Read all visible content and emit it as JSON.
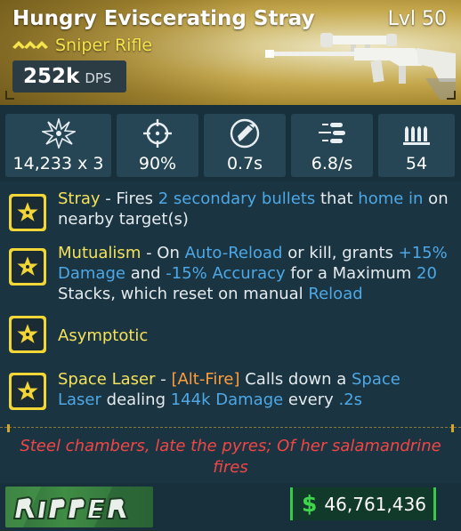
{
  "item": {
    "name": "Hungry Eviscerating Stray",
    "level": "Lvl 50",
    "rarity_icon": "legendary-chevrons-icon",
    "weapon_type": "Sniper Rifle",
    "dps_value": "252k",
    "dps_label": "DPS",
    "image": "sniper-rifle-image"
  },
  "stats": [
    {
      "icon": "damage-burst-icon",
      "value": "14,233 x 3"
    },
    {
      "icon": "crosshair-icon",
      "value": "90%"
    },
    {
      "icon": "reload-icon",
      "value": "0.7s"
    },
    {
      "icon": "fire-rate-icon",
      "value": "6.8/s"
    },
    {
      "icon": "magazine-icon",
      "value": "54"
    }
  ],
  "perks": [
    {
      "icon": "star-perk-icon",
      "name": "Stray",
      "segments": [
        {
          "t": " - Fires ",
          "c": ""
        },
        {
          "t": "2 secondary bullets",
          "c": "blue"
        },
        {
          "t": " that ",
          "c": ""
        },
        {
          "t": "home in",
          "c": "blue"
        },
        {
          "t": " on nearby target(s)",
          "c": ""
        }
      ]
    },
    {
      "icon": "star-perk-icon",
      "name": "Mutualism",
      "segments": [
        {
          "t": " - On ",
          "c": ""
        },
        {
          "t": "Auto-Reload",
          "c": "blue"
        },
        {
          "t": " or kill, grants ",
          "c": ""
        },
        {
          "t": "+15% Damage",
          "c": "blue"
        },
        {
          "t": " and ",
          "c": ""
        },
        {
          "t": "-15% Accuracy",
          "c": "blue"
        },
        {
          "t": " for a Maximum ",
          "c": ""
        },
        {
          "t": "20",
          "c": "blue"
        },
        {
          "t": " Stacks, which reset on manual ",
          "c": ""
        },
        {
          "t": "Reload",
          "c": "blue"
        }
      ]
    },
    {
      "icon": "star-perk-icon",
      "name": "Asymptotic",
      "segments": []
    },
    {
      "icon": "star-perk-icon",
      "name": "Space Laser",
      "segments": [
        {
          "t": " - ",
          "c": ""
        },
        {
          "t": "[Alt-Fire]",
          "c": "orange"
        },
        {
          "t": " Calls down a ",
          "c": ""
        },
        {
          "t": "Space Laser",
          "c": "blue"
        },
        {
          "t": " dealing ",
          "c": ""
        },
        {
          "t": "144k Damage",
          "c": "blue"
        },
        {
          "t": " every ",
          "c": ""
        },
        {
          "t": ".2s",
          "c": "blue"
        }
      ]
    }
  ],
  "flavor_text": "Steel chambers, late the pyres; Of her salamandrine fires",
  "footer": {
    "manufacturer_logo": "ripper-logo",
    "currency_icon": "dollar-icon",
    "currency_sign": "$",
    "price": "46,761,436"
  },
  "colors": {
    "rarity": "#c6a94f",
    "name_yellow": "#f5e25a",
    "keyword_blue": "#4ea8e6",
    "alt_orange": "#ff9d3b",
    "flavor_red": "#f24646",
    "money_green": "#36c94a"
  }
}
